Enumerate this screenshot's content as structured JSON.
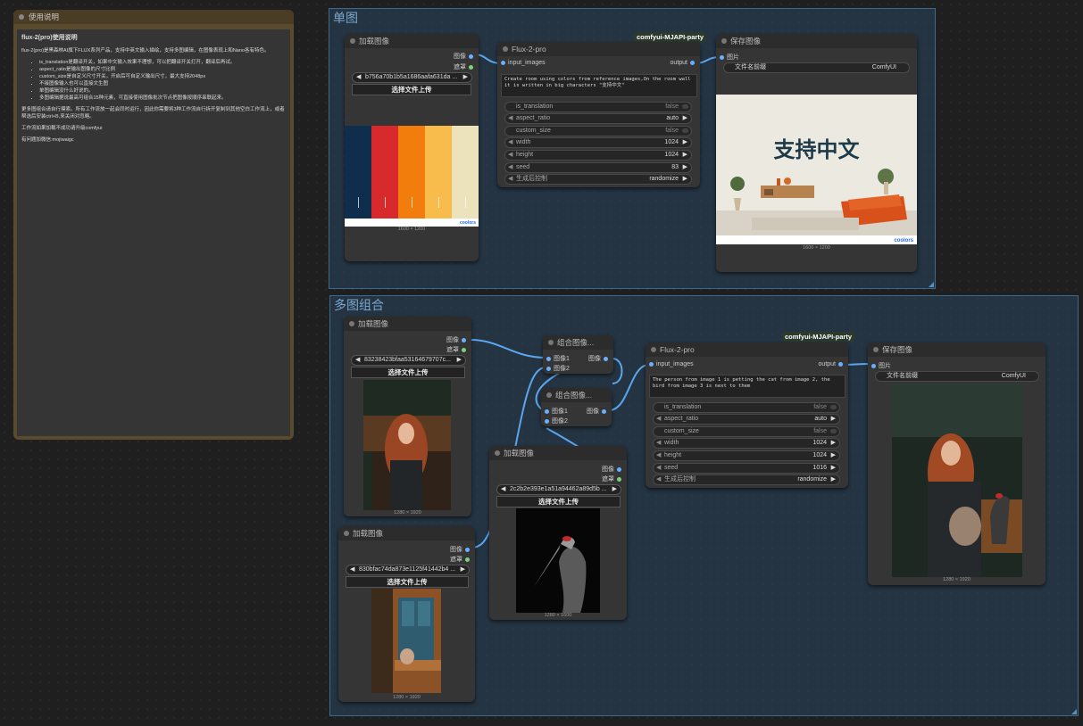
{
  "note": {
    "title": "使用说明",
    "heading": "flux-2(pro)使用说明",
    "intro": "flux-2(pro)是黑森林AI旗下FLUX系列产品，支持中英文输入描绘，支持多图编辑，在图像表现上和Nano各有特色。",
    "bullets": [
      "is_translation是翻译开关，如果中文输入效果不理想，可以把翻译开关打开，翻译后再试。",
      "aspect_ratio是输出图像的尺寸比例",
      "custom_size是自定义尺寸开关，开启后可自定义输出尺寸，最大支持2048px",
      "不接图像输入也可以直接文生图",
      "单图编辑没什么好说的。",
      "多图编辑据说最高可组合15种元素，可直接使用图像批次节点把图像按顺序串联起来。"
    ],
    "para2": "更多图组合请自行摸索。所有工作流放一起会同时运行，因此你需要将3种工作流自行拆开复制到其他空白工作流上，或者帮选后安装ctrl+B,来关闭对忽略。",
    "para3": "工作流如果加载不成功请升级comfyui",
    "para4": "有问题加微信:mojiwaigc"
  },
  "groups": {
    "single": "单图",
    "multi": "多图组合"
  },
  "colors": {
    "palette": [
      "#0f2d4d",
      "#d8292d",
      "#f27d0c",
      "#f8bc4d",
      "#ece3bc"
    ]
  },
  "common": {
    "load_image": "加载图像",
    "save_image": "保存图像",
    "flux": "Flux-2-pro",
    "badge": "comfyui-MJAPI-party",
    "out_image": "图像",
    "out_mask": "遮罩",
    "upload": "选择文件上传",
    "input_images": "input_images",
    "output": "output",
    "pictures": "图片",
    "filename_prefix": "文件名前缀",
    "filename_value": "ComfyUI",
    "combine": "组合图像...",
    "img1": "图像1",
    "img2": "图像2",
    "img_out": "图像"
  },
  "single": {
    "load_file": "b756a70b1b5a1686aafa631da ...",
    "load_dim": "1600 × 1200",
    "prompt": "Create room using colors from reference images,On the room wall it is written in big characters \"支持中文\"",
    "params": {
      "is_translation": "false",
      "aspect_ratio": "auto",
      "custom_size": "false",
      "width": "1024",
      "height": "1024",
      "seed": "83",
      "control": "randomize"
    },
    "save_text": "支持中文",
    "save_dim": "1600 × 1200",
    "logo": "coolors"
  },
  "multi": {
    "load1_file": "83238423bfaa53164679707c...",
    "load1_dim": "1280 × 1920",
    "load2_file": "830bfac74da873e1125f41442b4 ...",
    "load2_dim": "1280 × 1920",
    "load3_file": "2c2b2e393e1a51a94462a89d5b ...",
    "load3_dim": "1280 × 1600",
    "prompt": "The person from image 1 is petting the cat from image 2, the bird from image 3 is next to them",
    "params": {
      "is_translation": "false",
      "aspect_ratio": "auto",
      "custom_size": "false",
      "width": "1024",
      "height": "1024",
      "seed": "1016",
      "control": "randomize"
    },
    "save_dim": "1280 × 1920"
  },
  "labels": {
    "is_translation": "is_translation",
    "aspect_ratio": "aspect_ratio",
    "custom_size": "custom_size",
    "width": "width",
    "height": "height",
    "seed": "seed",
    "control": "生成后控制"
  }
}
